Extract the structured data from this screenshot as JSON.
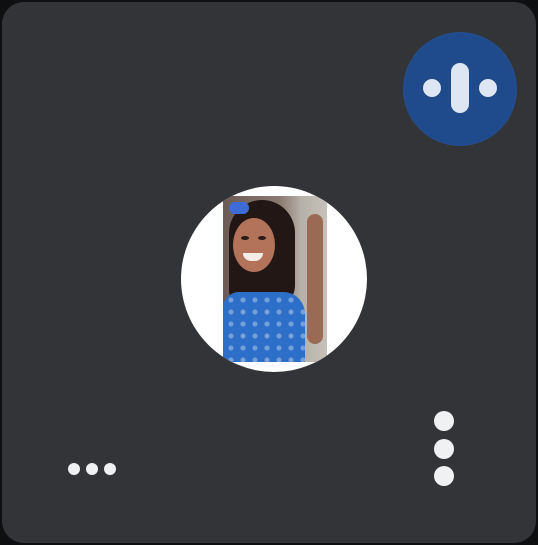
{
  "participant_tile": {
    "background_color": "#333437",
    "speaking_indicator_color": "#1f4a8c",
    "icons": {
      "speaking": "audio-level-icon",
      "options_left": "more-horizontal-icon",
      "options_right": "more-vertical-icon"
    }
  }
}
